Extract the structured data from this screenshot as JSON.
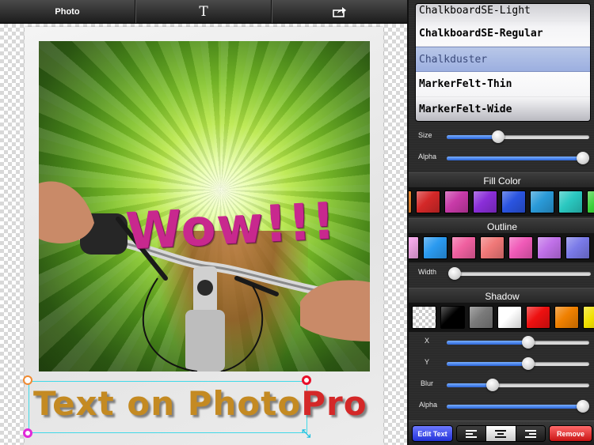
{
  "toolbar": {
    "photo_label": "Photo",
    "text_tool_glyph": "T",
    "share_icon": "share-icon"
  },
  "canvas": {
    "photo_text": "Wow!!!",
    "photo_text_color": "#c8288e",
    "caption_main": "Text on Photo",
    "caption_suffix": "Pro",
    "caption_main_color": "#c48a22",
    "caption_suffix_color": "#d42828"
  },
  "panel": {
    "fonts": [
      {
        "name": "ChalkboardSE-Light",
        "selected": false
      },
      {
        "name": "ChalkboardSE-Regular",
        "selected": false
      },
      {
        "name": "Chalkduster",
        "selected": true
      },
      {
        "name": "MarkerFelt-Thin",
        "selected": false
      },
      {
        "name": "MarkerFelt-Wide",
        "selected": false
      }
    ],
    "size_label": "Size",
    "size_value": 0.36,
    "alpha_label": "Alpha",
    "alpha_value": 1.0,
    "fill_color_header": "Fill Color",
    "fill_colors": [
      "#f08a30",
      "#d42828",
      "#c83aa8",
      "#8a2ed8",
      "#2a54e0",
      "#2a9ad8",
      "#2ac8c0",
      "#38d038",
      "#d8e020"
    ],
    "outline_header": "Outline",
    "outline_colors": [
      "#f4a8e8",
      "#2a9af0",
      "#f060a0",
      "#f07878",
      "#f05ab8",
      "#c070e8",
      "#7a7ae8"
    ],
    "width_label": "Width",
    "width_value": 0.0,
    "shadow_header": "Shadow",
    "shadow_colors": [
      "transparent",
      "#000000",
      "#7a7a7a",
      "#ffffff",
      "#ee1010",
      "#f08000",
      "#f0e000"
    ],
    "x_label": "X",
    "x_value": 0.57,
    "y_label": "Y",
    "y_value": 0.57,
    "blur_label": "Blur",
    "blur_value": 0.32,
    "shadow_alpha_label": "Alpha",
    "shadow_alpha_value": 1.0,
    "edit_text_label": "Edit Text",
    "remove_label": "Remove",
    "alignment": "center"
  }
}
